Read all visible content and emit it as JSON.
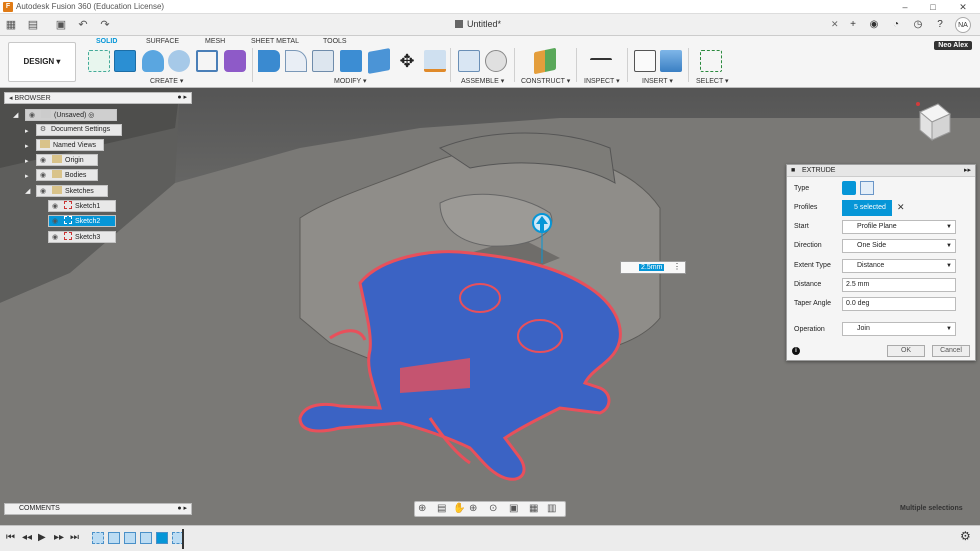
{
  "app": {
    "title": "Autodesk Fusion 360 (Education License)",
    "document_title": "Untitled*",
    "user": "Neo Alex",
    "user_initials": "NA",
    "workspace": "DESIGN"
  },
  "tabs": [
    "SOLID",
    "SURFACE",
    "MESH",
    "SHEET METAL",
    "TOOLS"
  ],
  "groups": [
    "CREATE",
    "MODIFY",
    "ASSEMBLE",
    "CONSTRUCT",
    "INSPECT",
    "INSERT",
    "SELECT"
  ],
  "browser": {
    "title": "BROWSER",
    "items": {
      "root": "(Unsaved)",
      "doc_settings": "Document Settings",
      "named_views": "Named Views",
      "origin": "Origin",
      "bodies": "Bodies",
      "sketches": "Sketches",
      "sketch1": "Sketch1",
      "sketch2": "Sketch2",
      "sketch3": "Sketch3"
    }
  },
  "extrude": {
    "title": "EXTRUDE",
    "labels": {
      "type": "Type",
      "profiles": "Profiles",
      "start": "Start",
      "direction": "Direction",
      "extent_type": "Extent Type",
      "distance": "Distance",
      "taper_angle": "Taper Angle",
      "operation": "Operation"
    },
    "values": {
      "profiles": "5 selected",
      "start": "Profile Plane",
      "direction": "One Side",
      "extent_type": "Distance",
      "distance": "2.5 mm",
      "taper_angle": "0.0 deg",
      "operation": "Join"
    },
    "ok": "OK",
    "cancel": "Cancel"
  },
  "dimension_input": "2.5mm",
  "comments": "COMMENTS",
  "status": "Multiple selections",
  "colors": {
    "accent": "#0696d7",
    "profile_fill": "#3b63c4",
    "profile_outline": "#e8505b"
  }
}
